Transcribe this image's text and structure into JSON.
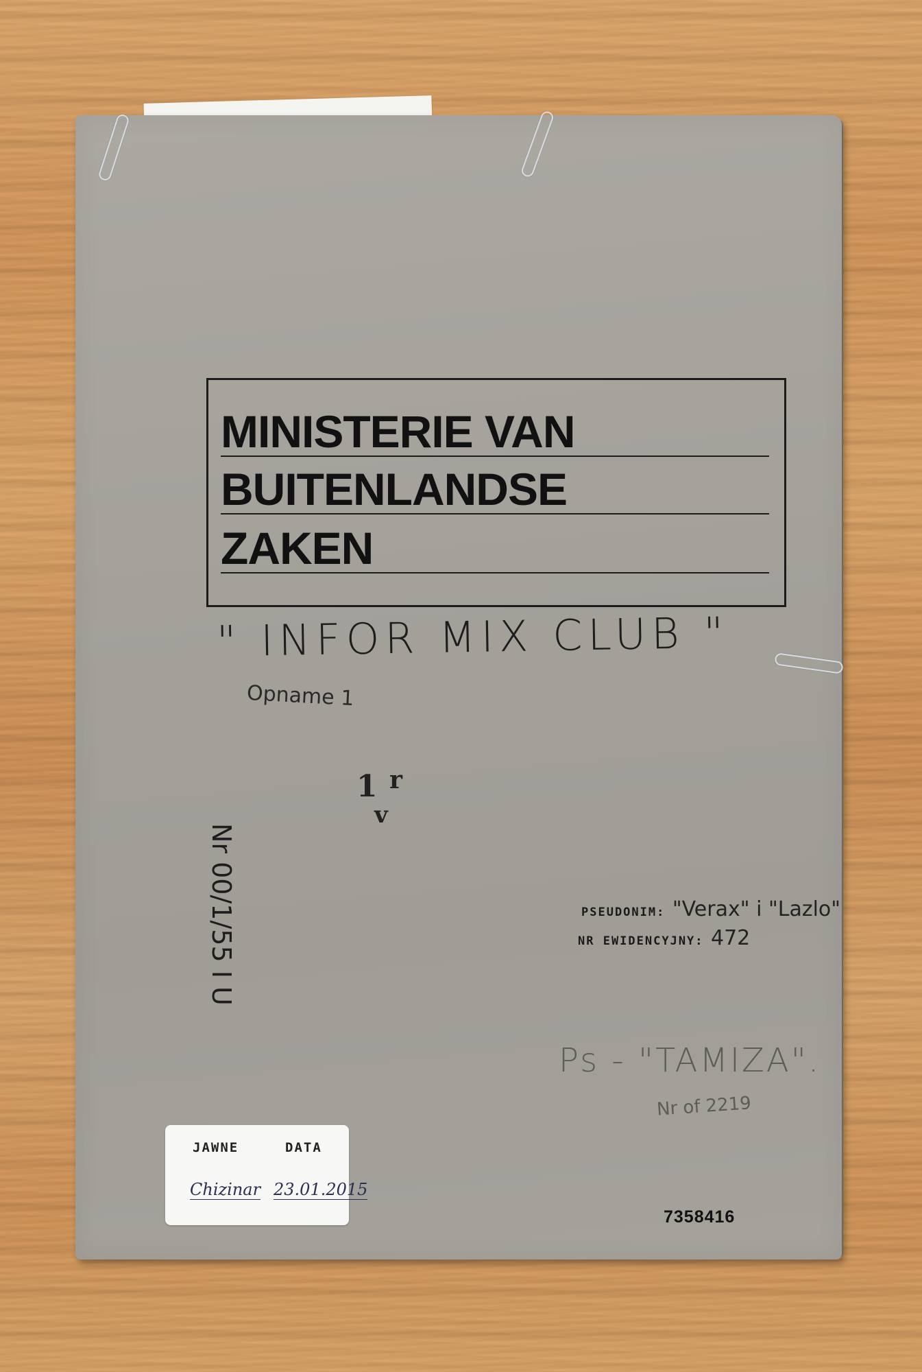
{
  "header": {
    "line1": "MINISTERIE VAN",
    "line2": "BUITENLANDSE",
    "line3": "ZAKEN"
  },
  "project_name": "\" INFOR MIX CLUB \"",
  "subtitle": "Opname 1",
  "vertical_reference": "Nr 00/1/55 I U",
  "stamp": {
    "main": "1",
    "sup": "r",
    "sub": "v"
  },
  "fields": {
    "pseudonim_label": "PSEUDONIM:",
    "pseudonim_value": "\"Verax\" i \"Lazlo\"",
    "nr_label": "NR EWIDENCYJNY:",
    "nr_value": "472"
  },
  "pencil_notes": {
    "line1": "Ps - \"TAMIZA\".",
    "line2": "Nr of 2219"
  },
  "sticker": {
    "label_left": "JAWNE",
    "label_right": "DATA",
    "signature": "Chizinar",
    "date": "23.01.2015"
  },
  "barcode_number": "7358416",
  "colors": {
    "folder": "#a3a19a",
    "desk": "#d49c60",
    "ink": "#1b1b1b",
    "pencil": "#5d5c58"
  }
}
